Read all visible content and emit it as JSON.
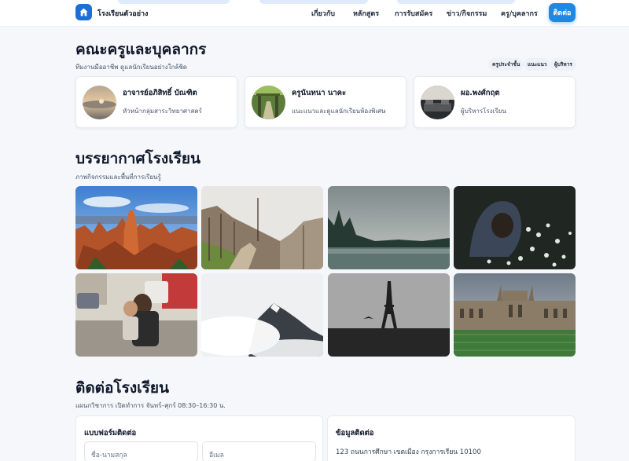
{
  "header": {
    "brand": "โรงเรียนตัวอย่าง",
    "nav": [
      "เกี่ยวกับ",
      "หลักสูตร",
      "การรับสมัคร",
      "ข่าว/กิจกรรม",
      "ครู/บุคลากร"
    ],
    "cta": "ติดต่อ",
    "logo_icon": "home-icon"
  },
  "staff": {
    "title": "คณะครูและบุคลากร",
    "subtitle": "ทีมงานมืออาชีพ ดูแลนักเรียนอย่างใกล้ชิด",
    "filters": [
      "ครูประจำชั้น",
      "แนะแนว",
      "ผู้บริหาร"
    ],
    "people": [
      {
        "name": "อาจารย์อภิสิทธิ์ บัณฑิต",
        "role": "หัวหน้ากลุ่มสาระวิทยาศาสตร์"
      },
      {
        "name": "ครูนันทนา นาคะ",
        "role": "แนะแนวและดูแลนักเรียนห้องพิเศษ"
      },
      {
        "name": "ผอ.พงศ์กฤต",
        "role": "ผู้บริหารโรงเรียน"
      }
    ]
  },
  "gallery": {
    "title": "บรรยากาศโรงเรียน",
    "subtitle": "ภาพกิจกรรมและพื้นที่การเรียนรู้",
    "photos": [
      "canyon",
      "foggy-forest-trail",
      "misty-lake",
      "hooded-person-flowers",
      "mother-child-street",
      "mountain-clouds",
      "eiffel-tower",
      "college-building"
    ]
  },
  "contact": {
    "title": "ติดต่อโรงเรียน",
    "subtitle": "แผนกวิชาการ เปิดทำการ จันทร์–ศุกร์ 08:30–16:30 น.",
    "form": {
      "title": "แบบฟอร์มติดต่อ",
      "name_placeholder": "ชื่อ-นามสกุล",
      "email_placeholder": "อีเมล"
    },
    "info": {
      "title": "ข้อมูลติดต่อ",
      "address": "123 ถนนการศึกษา เขตเมือง กรุงการเรียน 10100"
    }
  },
  "colors": {
    "accent": "#1e88e5",
    "text": "#0f172a",
    "muted": "#475569",
    "background": "#f5f7fa"
  }
}
